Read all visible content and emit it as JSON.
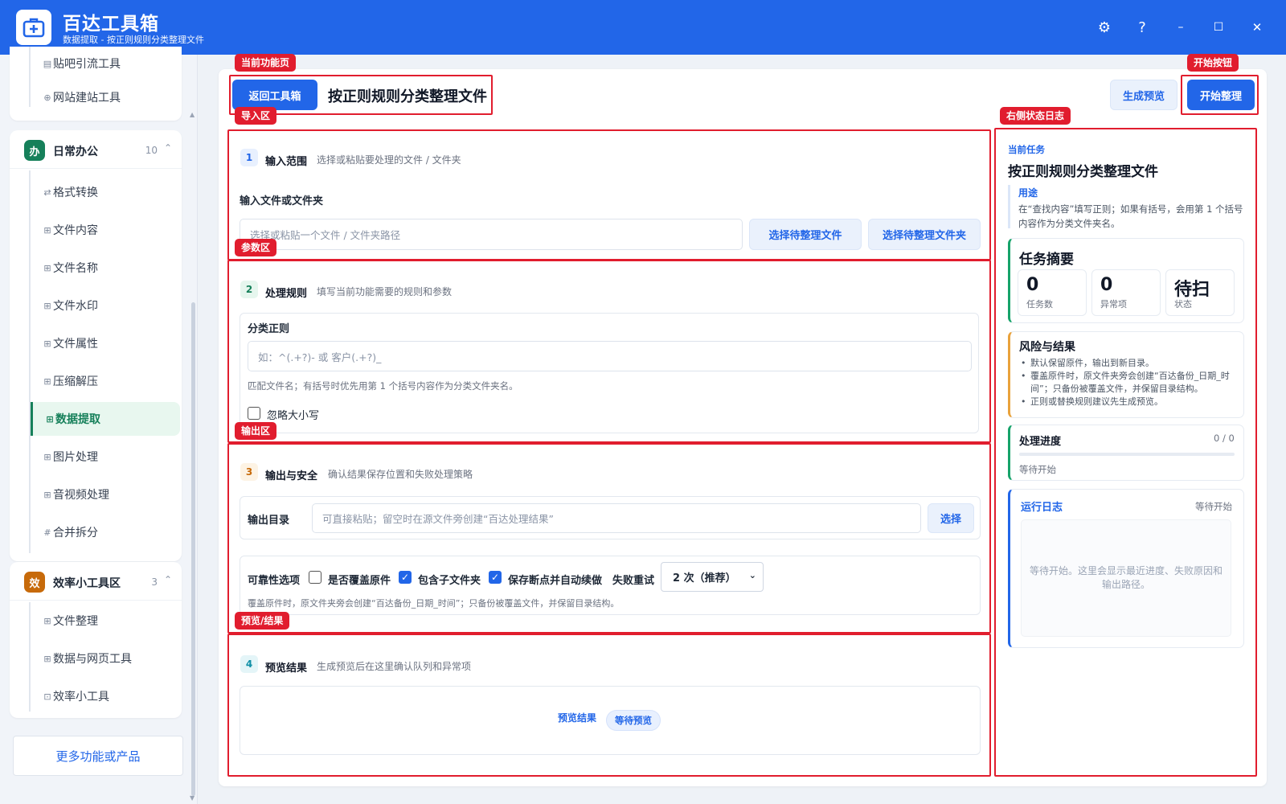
{
  "app": {
    "title": "百达工具箱",
    "subtitle": "数据提取 - 按正则规则分类整理文件"
  },
  "window_controls": {
    "settings": "⚙",
    "help": "?",
    "minimize": "–",
    "maximize": "☐",
    "close": "✕"
  },
  "sidebar": {
    "top_items": [
      {
        "label": "贴吧引流工具",
        "icon": "document-icon"
      },
      {
        "label": "网站建站工具",
        "icon": "globe-icon"
      }
    ],
    "groups": [
      {
        "badge": "办",
        "title": "日常办公",
        "count": "10",
        "color": "#16805a",
        "items": [
          {
            "label": "格式转换",
            "icon": "swap-icon"
          },
          {
            "label": "文件内容",
            "icon": "grid-icon"
          },
          {
            "label": "文件名称",
            "icon": "grid-icon"
          },
          {
            "label": "文件水印",
            "icon": "grid-icon"
          },
          {
            "label": "文件属性",
            "icon": "grid-icon"
          },
          {
            "label": "压缩解压",
            "icon": "grid-icon"
          },
          {
            "label": "数据提取",
            "icon": "grid-icon",
            "active": true
          },
          {
            "label": "图片处理",
            "icon": "grid-icon"
          },
          {
            "label": "音视频处理",
            "icon": "grid-icon"
          },
          {
            "label": "合并拆分",
            "icon": "hash-icon"
          }
        ]
      },
      {
        "badge": "效",
        "title": "效率小工具区",
        "count": "3",
        "color": "#c76a0a",
        "items": [
          {
            "label": "文件整理",
            "icon": "grid-icon"
          },
          {
            "label": "数据与网页工具",
            "icon": "grid-icon"
          },
          {
            "label": "效率小工具",
            "icon": "toolbox-icon"
          }
        ]
      }
    ],
    "more_button": "更多功能或产品"
  },
  "header": {
    "back_button": "返回工具箱",
    "page_title": "按正则规则分类整理文件",
    "preview_button": "生成预览",
    "start_button": "开始整理"
  },
  "annotations": {
    "current_page": "当前功能页",
    "start_button": "开始按钮",
    "import_area": "导入区",
    "right_log": "右侧状态日志",
    "param_area": "参数区",
    "output_area": "输出区",
    "preview_area": "预览/结果"
  },
  "section1": {
    "num": "1",
    "title": "输入范围",
    "desc": "选择或粘贴要处理的文件 / 文件夹",
    "field_label": "输入文件或文件夹",
    "placeholder": "选择或粘贴一个文件 / 文件夹路径",
    "choose_file": "选择待整理文件",
    "choose_folder": "选择待整理文件夹"
  },
  "section2": {
    "num": "2",
    "title": "处理规则",
    "desc": "填写当前功能需要的规则和参数",
    "field_label": "分类正则",
    "placeholder": "如：^(.+?)- 或 客户(.+?)_",
    "hint": "匹配文件名；有括号时优先用第 1 个括号内容作为分类文件夹名。",
    "ignore_case": "忽略大小写"
  },
  "section3": {
    "num": "3",
    "title": "输出与安全",
    "desc": "确认结果保存位置和失败处理策略",
    "output_label": "输出目录",
    "output_placeholder": "可直接粘贴；留空时在源文件旁创建“百达处理结果”",
    "choose": "选择",
    "reliability_label": "可靠性选项",
    "overwrite": "是否覆盖原件",
    "include_sub": "包含子文件夹",
    "resume": "保存断点并自动续做",
    "retry_label": "失败重试",
    "retry_value": "2 次（推荐）",
    "hint": "覆盖原件时，原文件夹旁会创建“百达备份_日期_时间”；只备份被覆盖文件，并保留目录结构。"
  },
  "section4": {
    "num": "4",
    "title": "预览结果",
    "desc": "生成预览后在这里确认队列和异常项",
    "result_label": "预览结果",
    "status": "等待预览"
  },
  "right_panel": {
    "current_task_label": "当前任务",
    "task_title": "按正则规则分类整理文件",
    "usage_label": "用途",
    "usage_text": "在“查找内容”填写正则；如果有括号，会用第 1 个括号内容作为分类文件夹名。",
    "summary_title": "任务摘要",
    "stats": [
      {
        "value": "0",
        "label": "任务数"
      },
      {
        "value": "0",
        "label": "异常项"
      },
      {
        "value": "待扫",
        "label": "状态"
      }
    ],
    "risk_title": "风险与结果",
    "risks": [
      "默认保留原件，输出到新目录。",
      "覆盖原件时，原文件夹旁会创建“百达备份_日期_时间”；只备份被覆盖文件，并保留目录结构。",
      "正则或替换规则建议先生成预览。"
    ],
    "progress_title": "处理进度",
    "progress_count": "0 / 0",
    "progress_fraction": 0,
    "progress_status": "等待开始",
    "log_title": "运行日志",
    "log_status": "等待开始",
    "log_placeholder": "等待开始。这里会显示最近进度、失败原因和输出路径。"
  },
  "colors": {
    "brand": "#2266e8",
    "annotation": "#e11d2e",
    "active": "#16805a",
    "risk": "#e9a23b"
  }
}
